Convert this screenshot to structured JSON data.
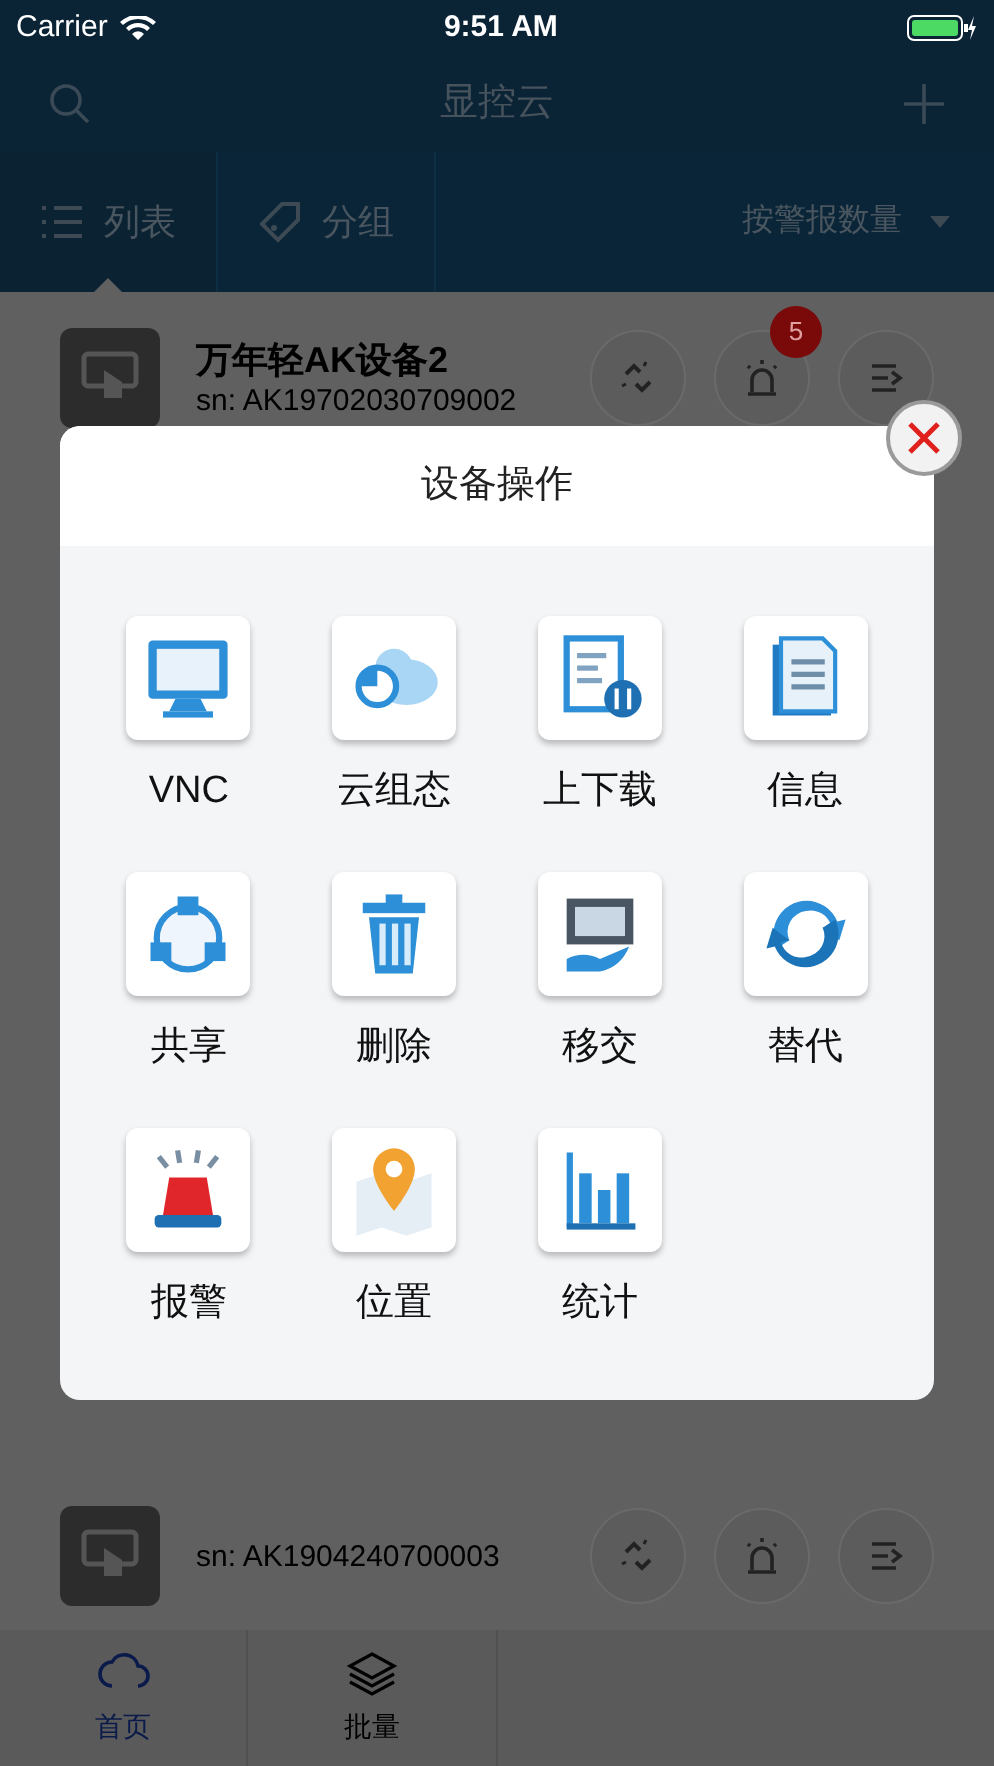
{
  "status_bar": {
    "carrier": "Carrier",
    "time": "9:51 AM"
  },
  "nav": {
    "title": "显控云"
  },
  "toolbar": {
    "tabs": [
      {
        "label": "列表",
        "selected": true
      },
      {
        "label": "分组",
        "selected": false
      }
    ],
    "sort": "按警报数量"
  },
  "devices": [
    {
      "name": "万年轻AK设备2",
      "sn": "sn: AK19702030709002",
      "alarm_count": "5"
    },
    {
      "sn": "sn: AK1904240700003"
    }
  ],
  "dialog": {
    "title": "设备操作",
    "actions": [
      {
        "label": "VNC"
      },
      {
        "label": "云组态"
      },
      {
        "label": "上下载"
      },
      {
        "label": "信息"
      },
      {
        "label": "共享"
      },
      {
        "label": "删除"
      },
      {
        "label": "移交"
      },
      {
        "label": "替代"
      },
      {
        "label": "报警"
      },
      {
        "label": "位置"
      },
      {
        "label": "统计"
      }
    ]
  },
  "tab_bar": {
    "tabs": [
      {
        "label": "首页",
        "selected": true
      },
      {
        "label": "批量",
        "selected": false
      }
    ]
  }
}
